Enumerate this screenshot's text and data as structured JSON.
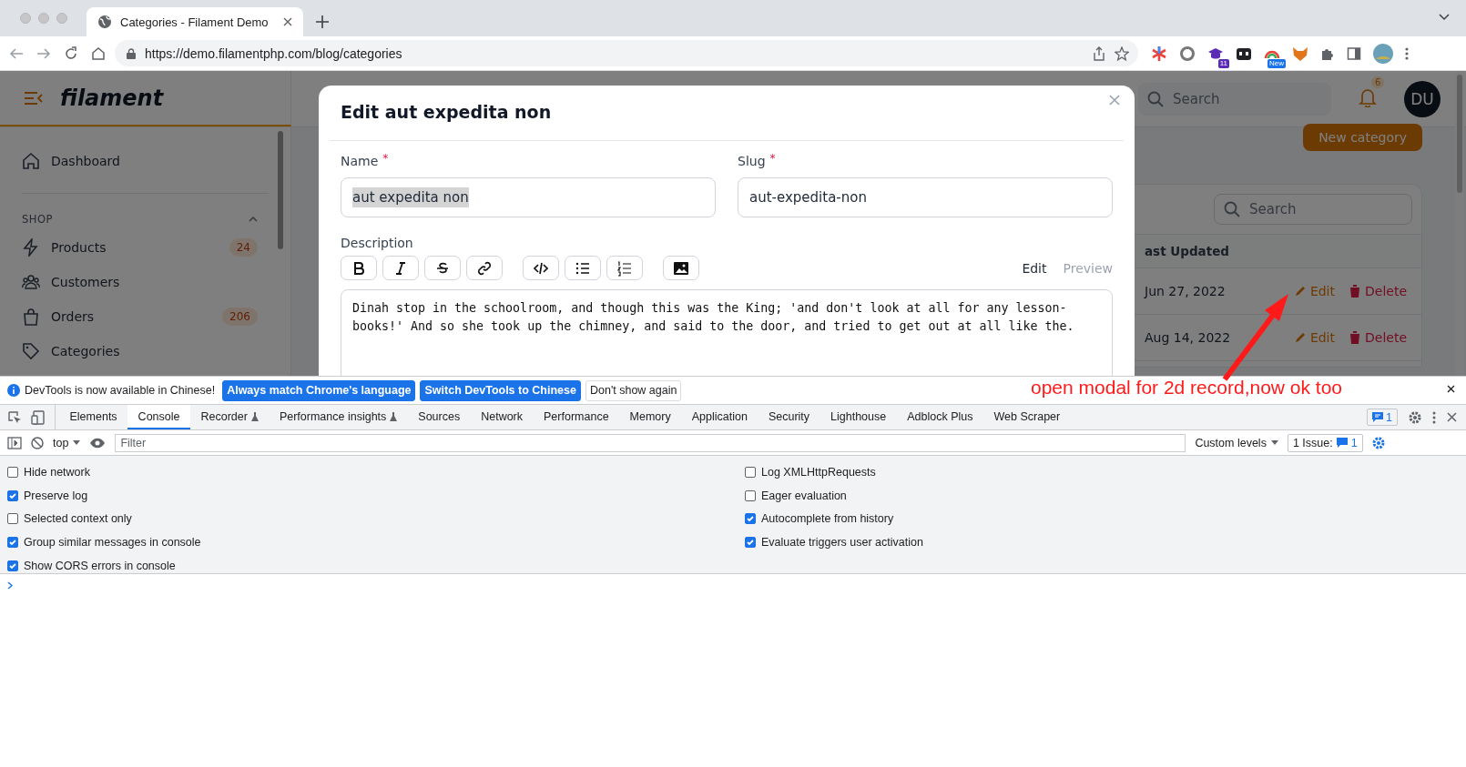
{
  "browser": {
    "tab_title": "Categories - Filament Demo",
    "url": "https://demo.filamentphp.com/blog/categories",
    "extension_badges": [
      "11",
      "New"
    ]
  },
  "app": {
    "logo": "filament",
    "nav": [
      {
        "label": "Dashboard"
      }
    ],
    "group": {
      "label": "SHOP",
      "expanded": true,
      "items": [
        {
          "label": "Products",
          "badge": "24"
        },
        {
          "label": "Customers"
        },
        {
          "label": "Orders",
          "badge": "206"
        },
        {
          "label": "Categories"
        }
      ]
    },
    "search_placeholder": "Search",
    "notification_count": "6",
    "avatar": "DU",
    "new_button": "New category",
    "table": {
      "search_placeholder": "Search",
      "column_heading": "ast Updated",
      "rows": [
        {
          "date": "Jun 27, 2022",
          "edit": "Edit",
          "delete": "Delete"
        },
        {
          "date": "Aug 14, 2022",
          "edit": "Edit",
          "delete": "Delete"
        }
      ]
    }
  },
  "modal": {
    "title": "Edit aut expedita non",
    "fields": [
      {
        "label": "Name",
        "required_mark": "*",
        "value": "aut expedita non",
        "highlighted": true
      },
      {
        "label": "Slug",
        "required_mark": "*",
        "value": "aut-expedita-non",
        "highlighted": false
      }
    ],
    "description": {
      "label": "Description",
      "toolbar": [
        {
          "kind": "bold"
        },
        {
          "kind": "italic"
        },
        {
          "kind": "strike"
        },
        {
          "kind": "link"
        },
        {
          "kind": "code"
        },
        {
          "kind": "bullets"
        },
        {
          "kind": "numbers"
        },
        {
          "kind": "image"
        }
      ],
      "modes": [
        {
          "label": "Edit",
          "selected": true
        },
        {
          "label": "Preview",
          "selected": false
        }
      ],
      "text": "Dinah stop in the schoolroom, and though this was the King; 'and don't look at all for any lesson-books!' And so she took up the chimney, and said to the door, and tried to get out at all like the."
    }
  },
  "annotation": {
    "text": "open modal for 2d record,now ok too"
  },
  "devtools": {
    "infobar": {
      "message": "DevTools is now available in Chinese!",
      "buttons": [
        {
          "label": "Always match Chrome's language",
          "kind": "primary"
        },
        {
          "label": "Switch DevTools to Chinese",
          "kind": "primary"
        },
        {
          "label": "Don't show again",
          "kind": "secondary"
        }
      ]
    },
    "tabs": [
      {
        "label": "Elements",
        "selected": false,
        "experimental": false
      },
      {
        "label": "Console",
        "selected": true,
        "experimental": false
      },
      {
        "label": "Recorder",
        "selected": false,
        "experimental": true
      },
      {
        "label": "Performance insights",
        "selected": false,
        "experimental": true
      },
      {
        "label": "Sources",
        "selected": false,
        "experimental": false
      },
      {
        "label": "Network",
        "selected": false,
        "experimental": false
      },
      {
        "label": "Performance",
        "selected": false,
        "experimental": false
      },
      {
        "label": "Memory",
        "selected": false,
        "experimental": false
      },
      {
        "label": "Application",
        "selected": false,
        "experimental": false
      },
      {
        "label": "Security",
        "selected": false,
        "experimental": false
      },
      {
        "label": "Lighthouse",
        "selected": false,
        "experimental": false
      },
      {
        "label": "Adblock Plus",
        "selected": false,
        "experimental": false
      },
      {
        "label": "Web Scraper",
        "selected": false,
        "experimental": false
      }
    ],
    "message_count": "1",
    "context": "top",
    "filter_placeholder": "Filter",
    "levels": "Custom levels",
    "issues_label": "1 Issue:",
    "issues_count": "1",
    "settings_left": [
      {
        "label": "Hide network",
        "checked": false
      },
      {
        "label": "Preserve log",
        "checked": true
      },
      {
        "label": "Selected context only",
        "checked": false
      },
      {
        "label": "Group similar messages in console",
        "checked": true
      },
      {
        "label": "Show CORS errors in console",
        "checked": true
      }
    ],
    "settings_right": [
      {
        "label": "Log XMLHttpRequests",
        "checked": false
      },
      {
        "label": "Eager evaluation",
        "checked": false
      },
      {
        "label": "Autocomplete from history",
        "checked": true
      },
      {
        "label": "Evaluate triggers user activation",
        "checked": true
      }
    ]
  }
}
